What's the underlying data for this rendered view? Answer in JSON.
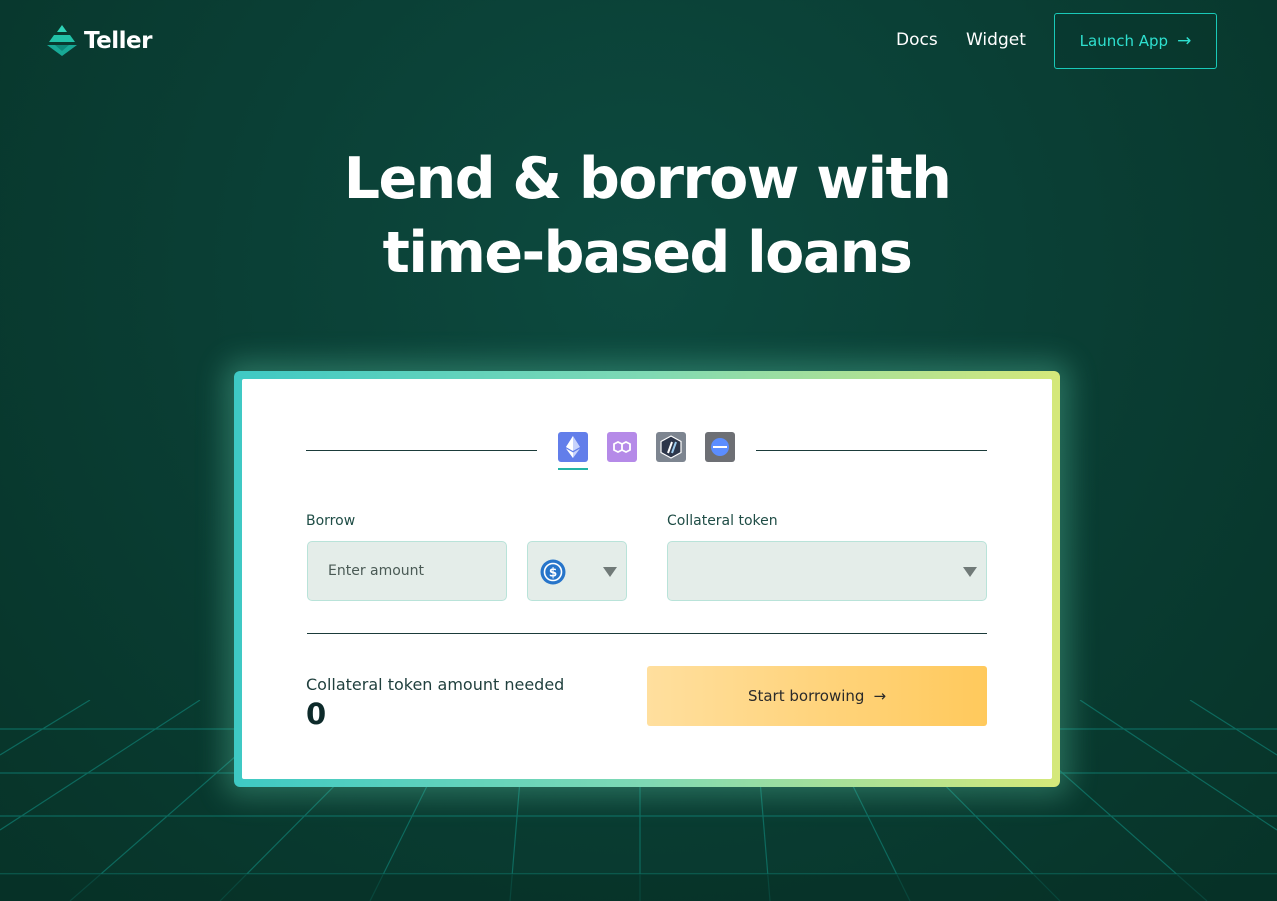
{
  "brand": {
    "name": "Teller"
  },
  "nav": {
    "docs": "Docs",
    "widget": "Widget",
    "launch_label": "Launch App",
    "launch_arrow": "→"
  },
  "hero": {
    "line1": "Lend & borrow with",
    "line2": "time-based loans"
  },
  "networks": [
    {
      "name": "ethereum-icon",
      "active": true
    },
    {
      "name": "polygon-icon",
      "active": false
    },
    {
      "name": "arbitrum-icon",
      "active": false
    },
    {
      "name": "base-icon",
      "active": false
    }
  ],
  "form": {
    "borrow_label": "Borrow",
    "amount_placeholder": "Enter amount",
    "borrow_token_icon": "usdc-icon",
    "collateral_label": "Collateral token",
    "collateral_value": ""
  },
  "summary": {
    "needed_label": "Collateral token amount needed",
    "needed_value": "0"
  },
  "cta": {
    "label": "Start borrowing",
    "arrow": "→"
  },
  "colors": {
    "background": "#0a3f35",
    "accent_teal": "#19c9b8",
    "cta_gradient_start": "#ffdf9e",
    "cta_gradient_end": "#ffc95c"
  }
}
